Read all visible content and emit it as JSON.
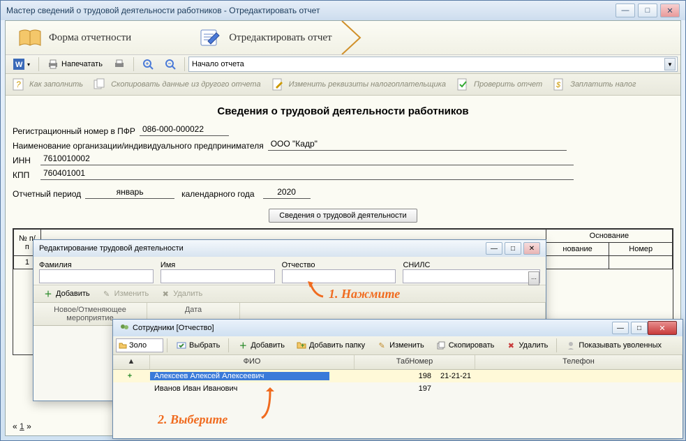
{
  "window": {
    "title": "Мастер сведений о трудовой деятельности работников - Отредактировать отчет"
  },
  "banner": {
    "step1": "Форма отчетности",
    "step2": "Отредактировать отчет"
  },
  "toolbar1": {
    "print": "Напечатать",
    "section_selector": "Начало отчета"
  },
  "helper": {
    "howto": "Как заполнить",
    "copy": "Скопировать данные из другого отчета",
    "req": "Изменить реквизиты налогоплательщика",
    "check": "Проверить отчет",
    "pay": "Заплатить налог"
  },
  "report": {
    "title": "Сведения о трудовой деятельности работников",
    "reg_label": "Регистрационный номер в ПФР",
    "reg_value": "086-000-000022",
    "org_label": "Наименование организации/индивидуального предпринимателя",
    "org_value": "ООО \"Кадр\"",
    "inn_label": "ИНН",
    "inn_value": "7610010002",
    "kpp_label": "КПП",
    "kpp_value": "760401001",
    "period_label": "Отчетный период",
    "period_month": "январь",
    "period_mid": "календарного года",
    "period_year": "2020",
    "details_btn": "Сведения о трудовой деятельности"
  },
  "grid": {
    "col_num": "№ п/п",
    "col_base": "Основание",
    "row1": "1",
    "new_cancel": "Новое/Отменяющее мероприятие",
    "date": "Дата",
    "novanie": "нование",
    "nomer": "Номер"
  },
  "pager": {
    "prev": "«",
    "page": "1",
    "next": "»"
  },
  "dlg1": {
    "title": "Редактирование трудовой деятельности",
    "fam": "Фамилия",
    "name": "Имя",
    "otch": "Отчество",
    "snils": "СНИЛС",
    "add": "Добавить",
    "edit": "Изменить",
    "del": "Удалить",
    "col_newcancel": "Новое/Отменяющее мероприятие",
    "col_date": "Дата"
  },
  "anno": {
    "a1": "1. Нажмите",
    "a2": "2. Выберите"
  },
  "dlg2": {
    "title": "Сотрудники [Отчество]",
    "folder": "Золо",
    "select": "Выбрать",
    "add": "Добавить",
    "addfolder": "Добавить папку",
    "edit": "Изменить",
    "copy": "Скопировать",
    "del": "Удалить",
    "showfired": "Показывать уволенных",
    "col_sort": "▲",
    "col_fio": "ФИО",
    "col_tab": "ТабНомер",
    "col_tel": "Телефон",
    "rows": [
      {
        "fio": "Алексеев Алексей Алексеевич",
        "tab": "198",
        "tel": "21-21-21",
        "sel": true
      },
      {
        "fio": "Иванов Иван Иванович",
        "tab": "197",
        "tel": "",
        "sel": false
      }
    ]
  }
}
